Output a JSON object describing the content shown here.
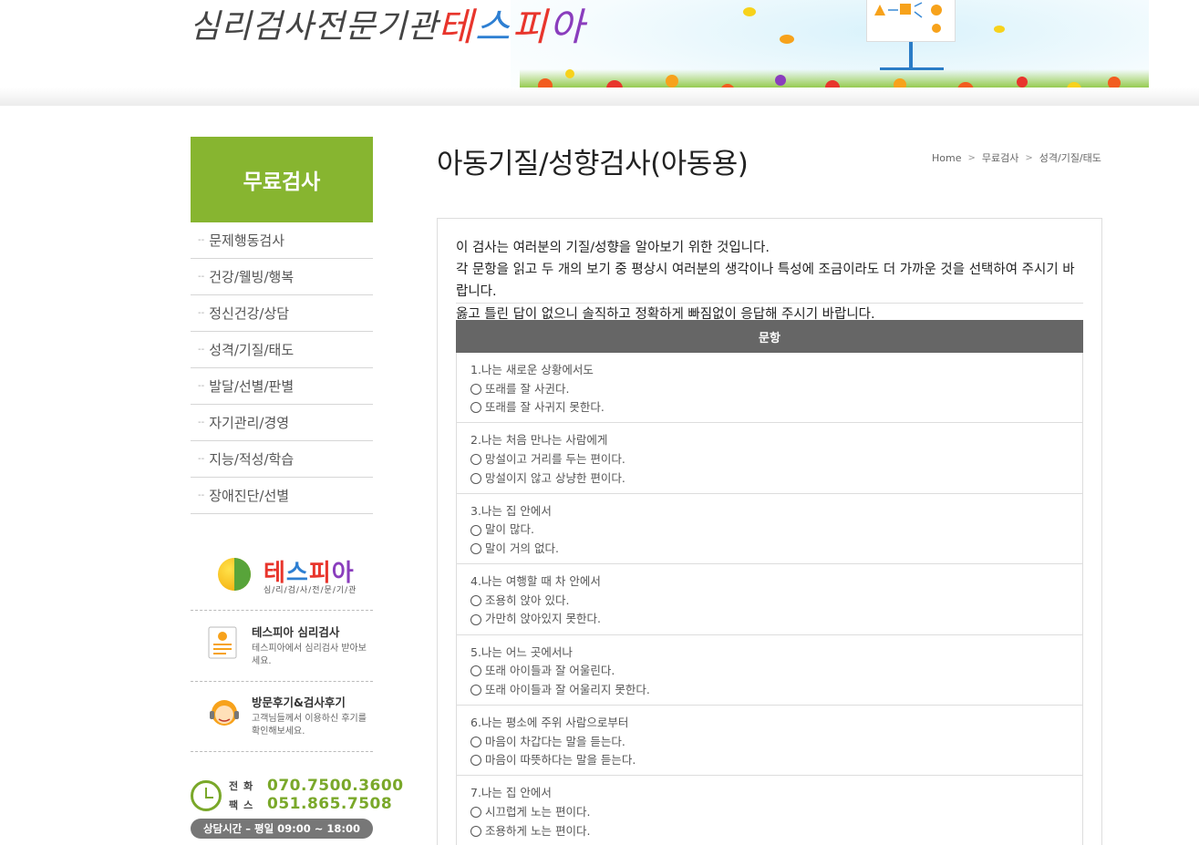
{
  "header": {
    "logo_text": "심리검사전문기관",
    "brand_chars": [
      "테",
      "스",
      "피",
      "아"
    ]
  },
  "sidebar": {
    "title": "무료검사",
    "items": [
      {
        "label": "문제행동검사"
      },
      {
        "label": "건강/웰빙/행복"
      },
      {
        "label": "정신건강/상담"
      },
      {
        "label": "성격/기질/태도"
      },
      {
        "label": "발달/선별/판별"
      },
      {
        "label": "자기관리/경영"
      },
      {
        "label": "지능/적성/학습"
      },
      {
        "label": "장애진단/선별"
      }
    ],
    "logo_banner": {
      "name_chars": [
        "테",
        "스",
        "피",
        "아"
      ],
      "sub": "심/리/검/사/전/문/기/관"
    },
    "banner_test": {
      "title": "테스피아 심리검사",
      "desc": "테스피아에서 심리검사 받아보세요."
    },
    "banner_review": {
      "title": "방문후기&검사후기",
      "desc": "고객님들께서 이용하신 후기를 확인해보세요."
    },
    "contact": {
      "phone_label": "전화",
      "phone": "070.7500.3600",
      "fax_label": "팩스",
      "fax": "051.865.7508",
      "hours": "상담시간 – 평일 09:00 ~ 18:00"
    }
  },
  "main": {
    "title": "아동기질/성향검사(아동용)",
    "breadcrumb": [
      "Home",
      "무료검사",
      "성격/기질/태도"
    ],
    "intro": [
      "이 검사는 여러분의 기질/성향을 알아보기 위한 것입니다.",
      "각 문항을 읽고 두 개의 보기 중 평상시 여러분의 생각이나 특성에 조금이라도 더 가까운 것을 선택하여 주시기 바랍니다.",
      "옳고 틀린 답이 없으니 솔직하고 정확하게 빠짐없이 응답해 주시기 바랍니다."
    ],
    "table_header": "문항",
    "questions": [
      {
        "q": "1.나는 새로운 상황에서도",
        "options": [
          "또래를 잘 사귄다.",
          "또래를 잘 사귀지 못한다."
        ]
      },
      {
        "q": "2.나는 처음 만나는 사람에게",
        "options": [
          "망설이고 거리를 두는 편이다.",
          "망설이지 않고 상냥한 편이다."
        ]
      },
      {
        "q": "3.나는 집 안에서",
        "options": [
          "말이 많다.",
          "말이 거의 없다."
        ]
      },
      {
        "q": "4.나는 여행할 때 차 안에서",
        "options": [
          "조용히 앉아 있다.",
          "가만히 앉아있지 못한다."
        ]
      },
      {
        "q": "5.나는 어느 곳에서나",
        "options": [
          "또래 아이들과 잘 어울린다.",
          "또래 아이들과 잘 어울리지 못한다."
        ]
      },
      {
        "q": "6.나는 평소에 주위 사람으로부터",
        "options": [
          "마음이 차갑다는 말을 듣는다.",
          "마음이 따뜻하다는 말을 듣는다."
        ]
      },
      {
        "q": "7.나는 집 안에서",
        "options": [
          "시끄럽게 노는 편이다.",
          "조용하게 노는 편이다."
        ]
      }
    ]
  },
  "colors": {
    "accent_green": "#87b530",
    "table_header_bg": "#666666",
    "contact_green": "#7aa82a"
  }
}
